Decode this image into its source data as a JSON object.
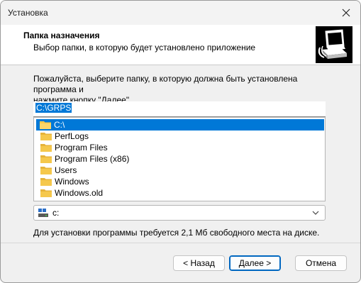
{
  "window": {
    "title": "Установка"
  },
  "header": {
    "title": "Папка назначения",
    "subtitle": "Выбор папки, в которую будет установлено приложение",
    "image_icon": "installer-computer-icon"
  },
  "main": {
    "description_line1": "Пожалуйста, выберите папку, в которую должна быть установлена программа и",
    "description_line2": "нажмите кнопку \"Далее\".",
    "path_value": "C:\\GRPS",
    "folders": [
      {
        "label": "C:\\",
        "selected": true,
        "depth": 0
      },
      {
        "label": "PerfLogs",
        "selected": false,
        "depth": 1
      },
      {
        "label": "Program Files",
        "selected": false,
        "depth": 1
      },
      {
        "label": "Program Files (x86)",
        "selected": false,
        "depth": 1
      },
      {
        "label": "Users",
        "selected": false,
        "depth": 1
      },
      {
        "label": "Windows",
        "selected": false,
        "depth": 1
      },
      {
        "label": "Windows.old",
        "selected": false,
        "depth": 1
      }
    ],
    "drive": {
      "selected": "c:",
      "icon": "drive-icon"
    },
    "space_required": "Для установки программы требуется 2,1 Мб свободного места на диске."
  },
  "buttons": {
    "back": "< Назад",
    "next": "Далее >",
    "cancel": "Отмена"
  },
  "colors": {
    "selection": "#0078d7",
    "folder": "#f5c84c",
    "accent_border": "#0067c0"
  }
}
